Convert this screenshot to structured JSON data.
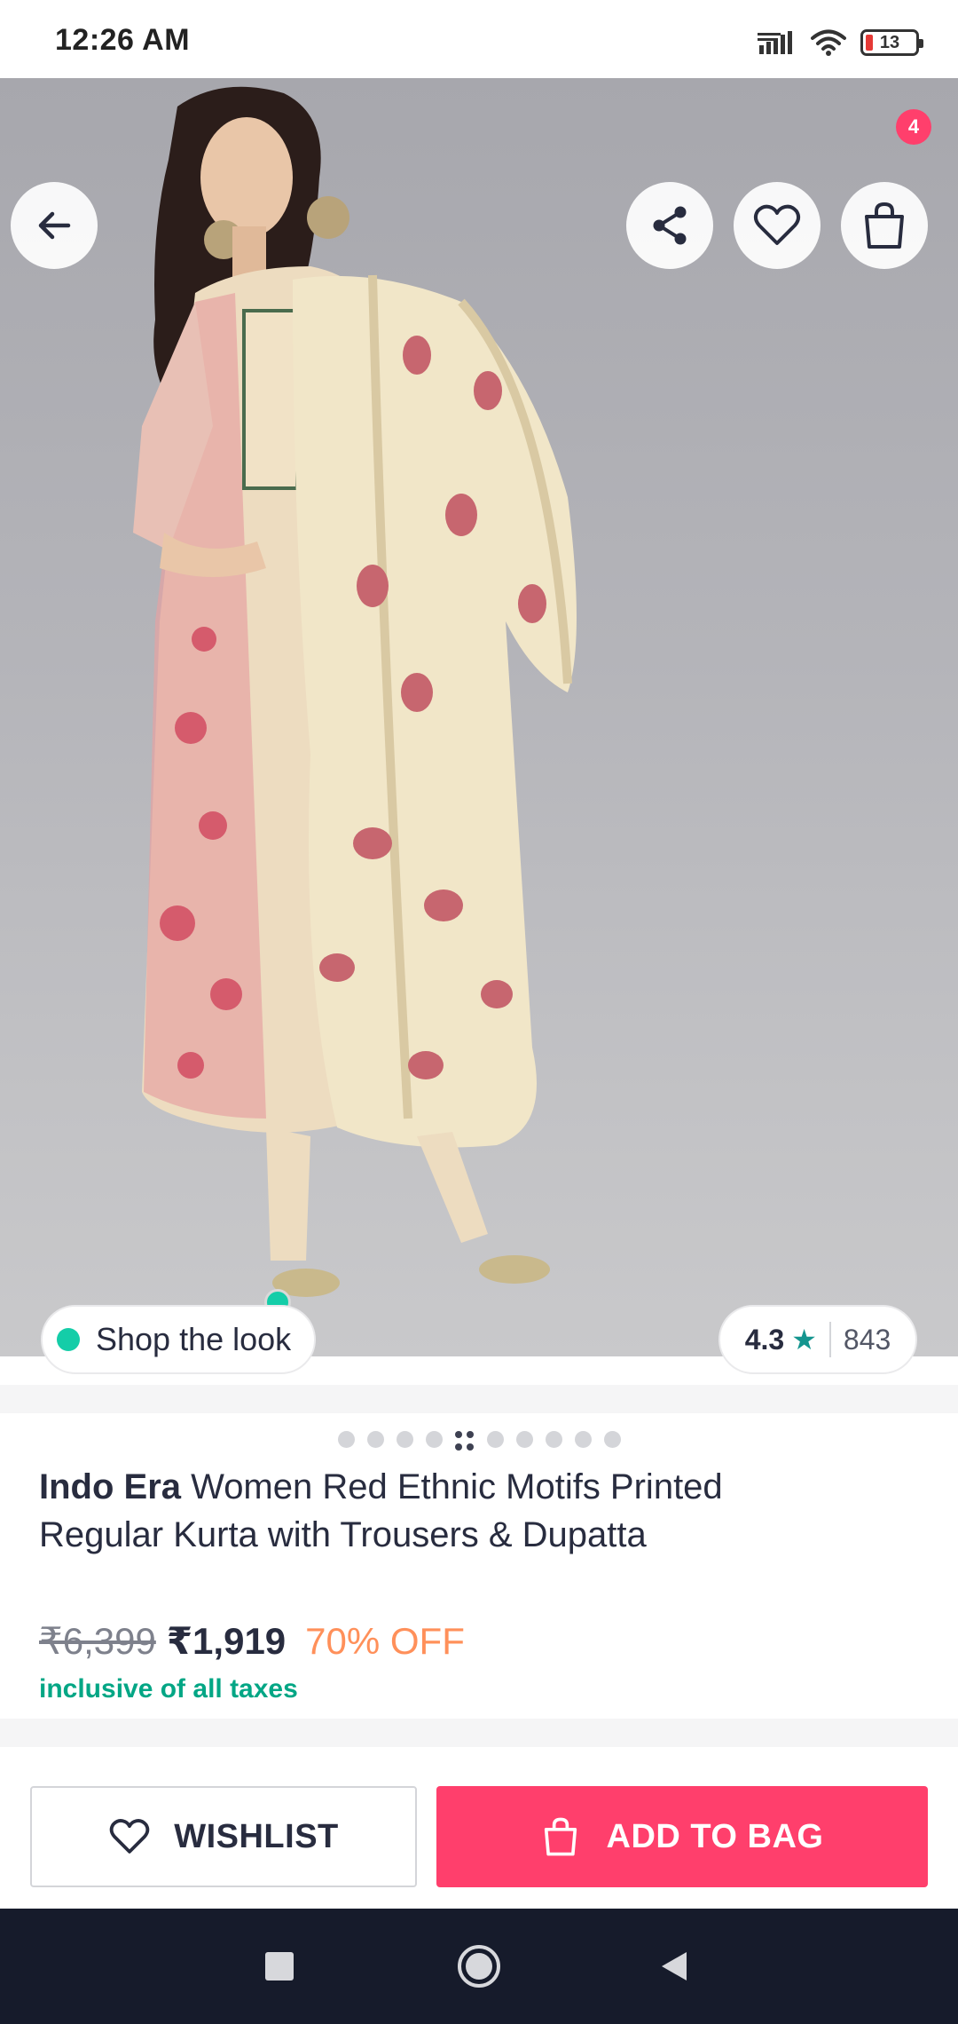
{
  "status_bar": {
    "time": "12:26 AM",
    "battery_level": "13",
    "icons": [
      "signal-icon",
      "wifi-icon",
      "battery-icon"
    ]
  },
  "header": {
    "bag_count": "4",
    "icons": [
      "back-arrow-icon",
      "share-icon",
      "heart-icon",
      "shopping-bag-icon"
    ]
  },
  "hero": {
    "shop_the_look_label": "Shop the look",
    "rating_value": "4.3",
    "rating_star": "★",
    "rating_count": "843",
    "carousel_total": 10,
    "carousel_active_index": 4
  },
  "product": {
    "brand": "Indo Era",
    "name": "Women Red Ethnic Motifs Printed Regular Kurta with Trousers & Dupatta",
    "mrp": "₹6,399",
    "price": "₹1,919",
    "discount": "70% OFF",
    "tax_note": "inclusive of all taxes"
  },
  "actions": {
    "wishlist_label": "WISHLIST",
    "add_to_bag_label": "ADD TO BAG"
  },
  "colors": {
    "accent": "#ff3f6c",
    "discount": "#ff905a",
    "tax_note": "#03a685",
    "rating_star": "#14958f",
    "nav_bar": "#161b2b"
  },
  "nav": {
    "icons": [
      "recents-square-icon",
      "home-circle-icon",
      "back-triangle-icon"
    ]
  }
}
